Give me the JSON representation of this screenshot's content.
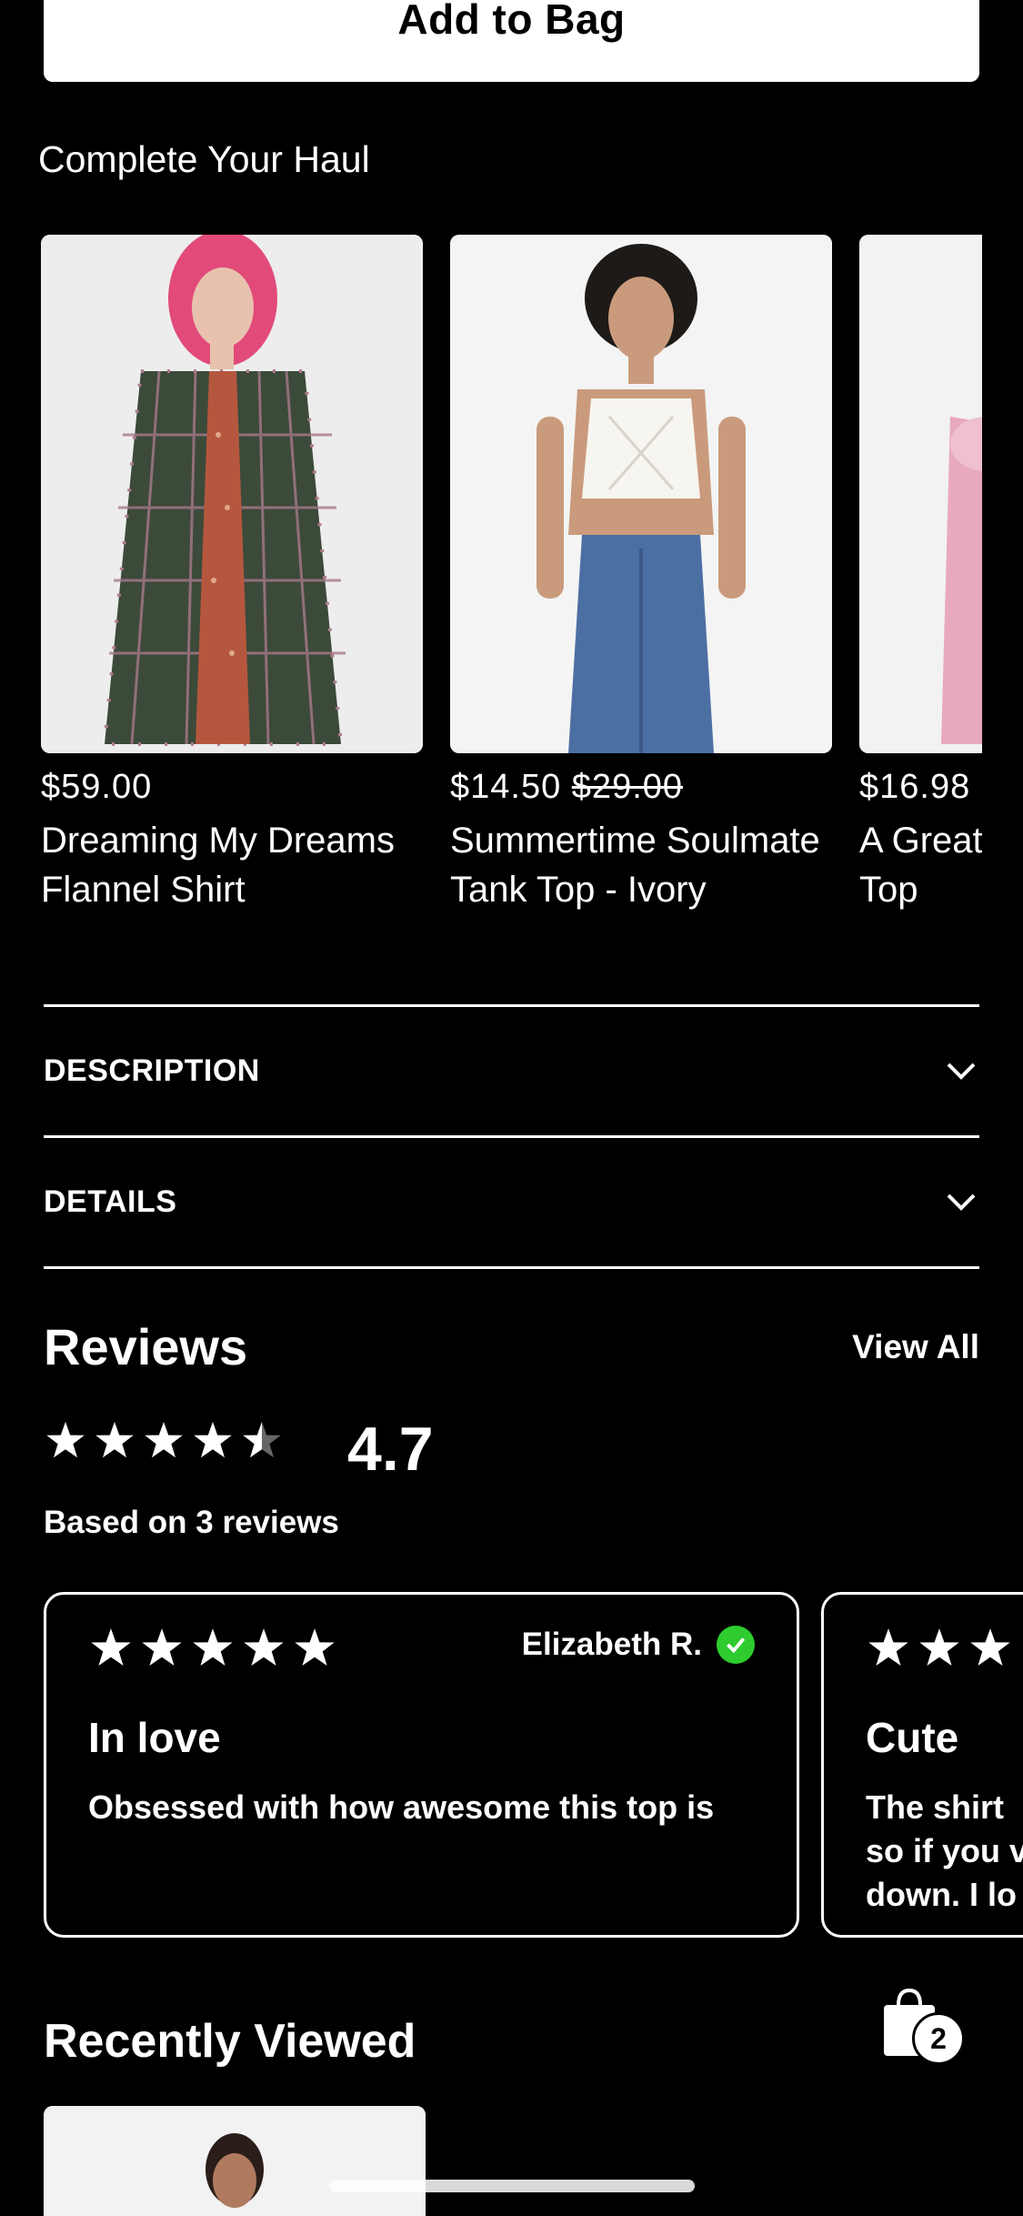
{
  "add_to_bag": {
    "label": "Add to Bag"
  },
  "haul": {
    "title": "Complete Your Haul",
    "products": [
      {
        "price": "$59.00",
        "name_line1": "Dreaming My Dreams",
        "name_line2": "Flannel Shirt"
      },
      {
        "price": "$14.50",
        "original_price": "$29.00",
        "name_line1": "Summertime Soulmate",
        "name_line2": "Tank Top - Ivory"
      },
      {
        "price": "$16.98",
        "name_line1": "A Great",
        "name_line2": "Top"
      }
    ]
  },
  "accordions": {
    "description": "DESCRIPTION",
    "details": "DETAILS"
  },
  "reviews": {
    "title": "Reviews",
    "view_all": "View All",
    "rating": "4.7",
    "based_on": "Based on 3 reviews",
    "cards": [
      {
        "reviewer": "Elizabeth R.",
        "title": "In love",
        "body": "Obsessed with how awesome this top is"
      },
      {
        "title": "Cute",
        "body_line1": "The shirt",
        "body_line2": "so if you v",
        "body_line3": "down. I lo"
      }
    ]
  },
  "recently_viewed": {
    "title": "Recently Viewed"
  },
  "bag": {
    "count": "2"
  },
  "colors": {
    "background": "#000000",
    "foreground": "#ffffff",
    "verified": "#2ecc2e"
  }
}
